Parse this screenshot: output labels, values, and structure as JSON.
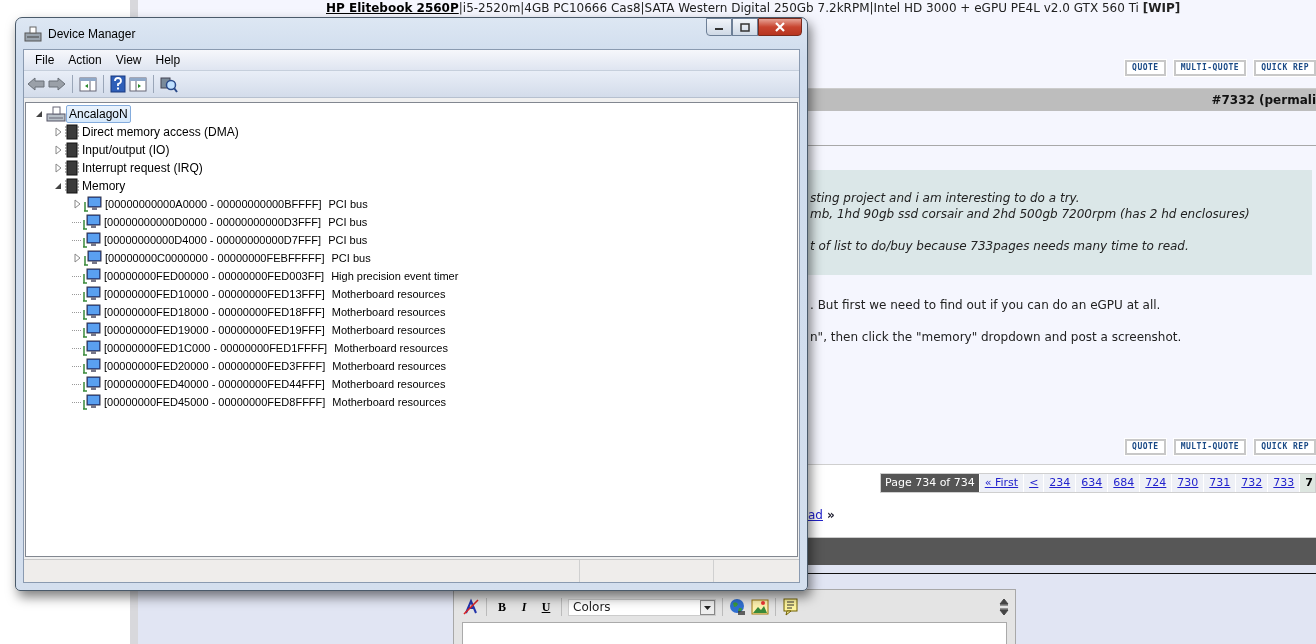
{
  "page": {
    "signature": {
      "link": "HP Elitebook 2560P",
      "text": "|i5-2520m|4GB PC10666 Cas8|SATA Western Digital 250Gb 7.2kRPM|Intel HD 3000 + eGPU PE4L v2.0 GTX 560 Ti **[WIP]**"
    },
    "post_buttons": [
      "QUOTE",
      "MULTI-QUOTE",
      "QUICK REP"
    ],
    "post_header": "#7332 (permali",
    "quote_lines": [
      "sting project and i am interesting to do a try.",
      "mb, 1hd 90gb ssd corsair and 2hd 500gb 7200rpm (has 2 hd enclosures)",
      "t of list to do/buy because 733pages needs many time to read."
    ],
    "reply_lines": [
      ". But first we need to find out if you can do an eGPU at all.",
      "n\", then click the \"memory\" dropdown and post a screenshot."
    ],
    "post_buttons_2": [
      "QUOTE",
      "MULTI-QUOTE",
      "QUICK REP"
    ],
    "pagination": {
      "label": "Page 734 of 734",
      "pages": [
        {
          "label": "« First",
          "selected": false
        },
        {
          "label": "<",
          "selected": false
        },
        {
          "label": "234",
          "selected": false
        },
        {
          "label": "634",
          "selected": false
        },
        {
          "label": "684",
          "selected": false
        },
        {
          "label": "724",
          "selected": false
        },
        {
          "label": "730",
          "selected": false
        },
        {
          "label": "731",
          "selected": false
        },
        {
          "label": "732",
          "selected": false
        },
        {
          "label": "733",
          "selected": false
        },
        {
          "label": "7",
          "selected": true
        }
      ]
    },
    "thread_nav": {
      "link": "ad",
      "arrow": "»"
    },
    "editor": {
      "format_buttons": [
        "B",
        "I",
        "U"
      ],
      "colors_select": "Colors"
    }
  },
  "window": {
    "title": "Device Manager",
    "menu": [
      "File",
      "Action",
      "View",
      "Help"
    ],
    "tree": {
      "kind": "computer",
      "label": "AncalagoN",
      "selected": true,
      "expanded": true,
      "children": [
        {
          "kind": "category",
          "label": "Direct memory access (DMA)",
          "selected": false,
          "expanded": false
        },
        {
          "kind": "category",
          "label": "Input/output (IO)",
          "selected": false,
          "expanded": false
        },
        {
          "kind": "category",
          "label": "Interrupt request (IRQ)",
          "selected": false,
          "expanded": false
        },
        {
          "kind": "category",
          "label": "Memory",
          "selected": false,
          "expanded": true,
          "children": [
            {
              "kind": "resource",
              "range": "[00000000000A0000 - 00000000000BFFFF]",
              "description": "PCI bus",
              "selected": false,
              "expanded": false
            },
            {
              "kind": "resource",
              "range": "[00000000000D0000 - 00000000000D3FFF]",
              "description": "PCI bus",
              "selected": false
            },
            {
              "kind": "resource",
              "range": "[00000000000D4000 - 00000000000D7FFF]",
              "description": "PCI bus",
              "selected": false
            },
            {
              "kind": "resource",
              "range": "[00000000C0000000 - 00000000FEBFFFFF]",
              "description": "PCI bus",
              "selected": false,
              "expanded": false
            },
            {
              "kind": "resource",
              "range": "[00000000FED00000 - 00000000FED003FF]",
              "description": "High precision event timer",
              "selected": false
            },
            {
              "kind": "resource",
              "range": "[00000000FED10000 - 00000000FED13FFF]",
              "description": "Motherboard resources",
              "selected": false
            },
            {
              "kind": "resource",
              "range": "[00000000FED18000 - 00000000FED18FFF]",
              "description": "Motherboard resources",
              "selected": false
            },
            {
              "kind": "resource",
              "range": "[00000000FED19000 - 00000000FED19FFF]",
              "description": "Motherboard resources",
              "selected": false
            },
            {
              "kind": "resource",
              "range": "[00000000FED1C000 - 00000000FED1FFFF]",
              "description": "Motherboard resources",
              "selected": false
            },
            {
              "kind": "resource",
              "range": "[00000000FED20000 - 00000000FED3FFFF]",
              "description": "Motherboard resources",
              "selected": false
            },
            {
              "kind": "resource",
              "range": "[00000000FED40000 - 00000000FED44FFF]",
              "description": "Motherboard resources",
              "selected": false
            },
            {
              "kind": "resource",
              "range": "[00000000FED45000 - 00000000FED8FFFF]",
              "description": "Motherboard resources",
              "selected": false
            }
          ]
        }
      ]
    }
  }
}
